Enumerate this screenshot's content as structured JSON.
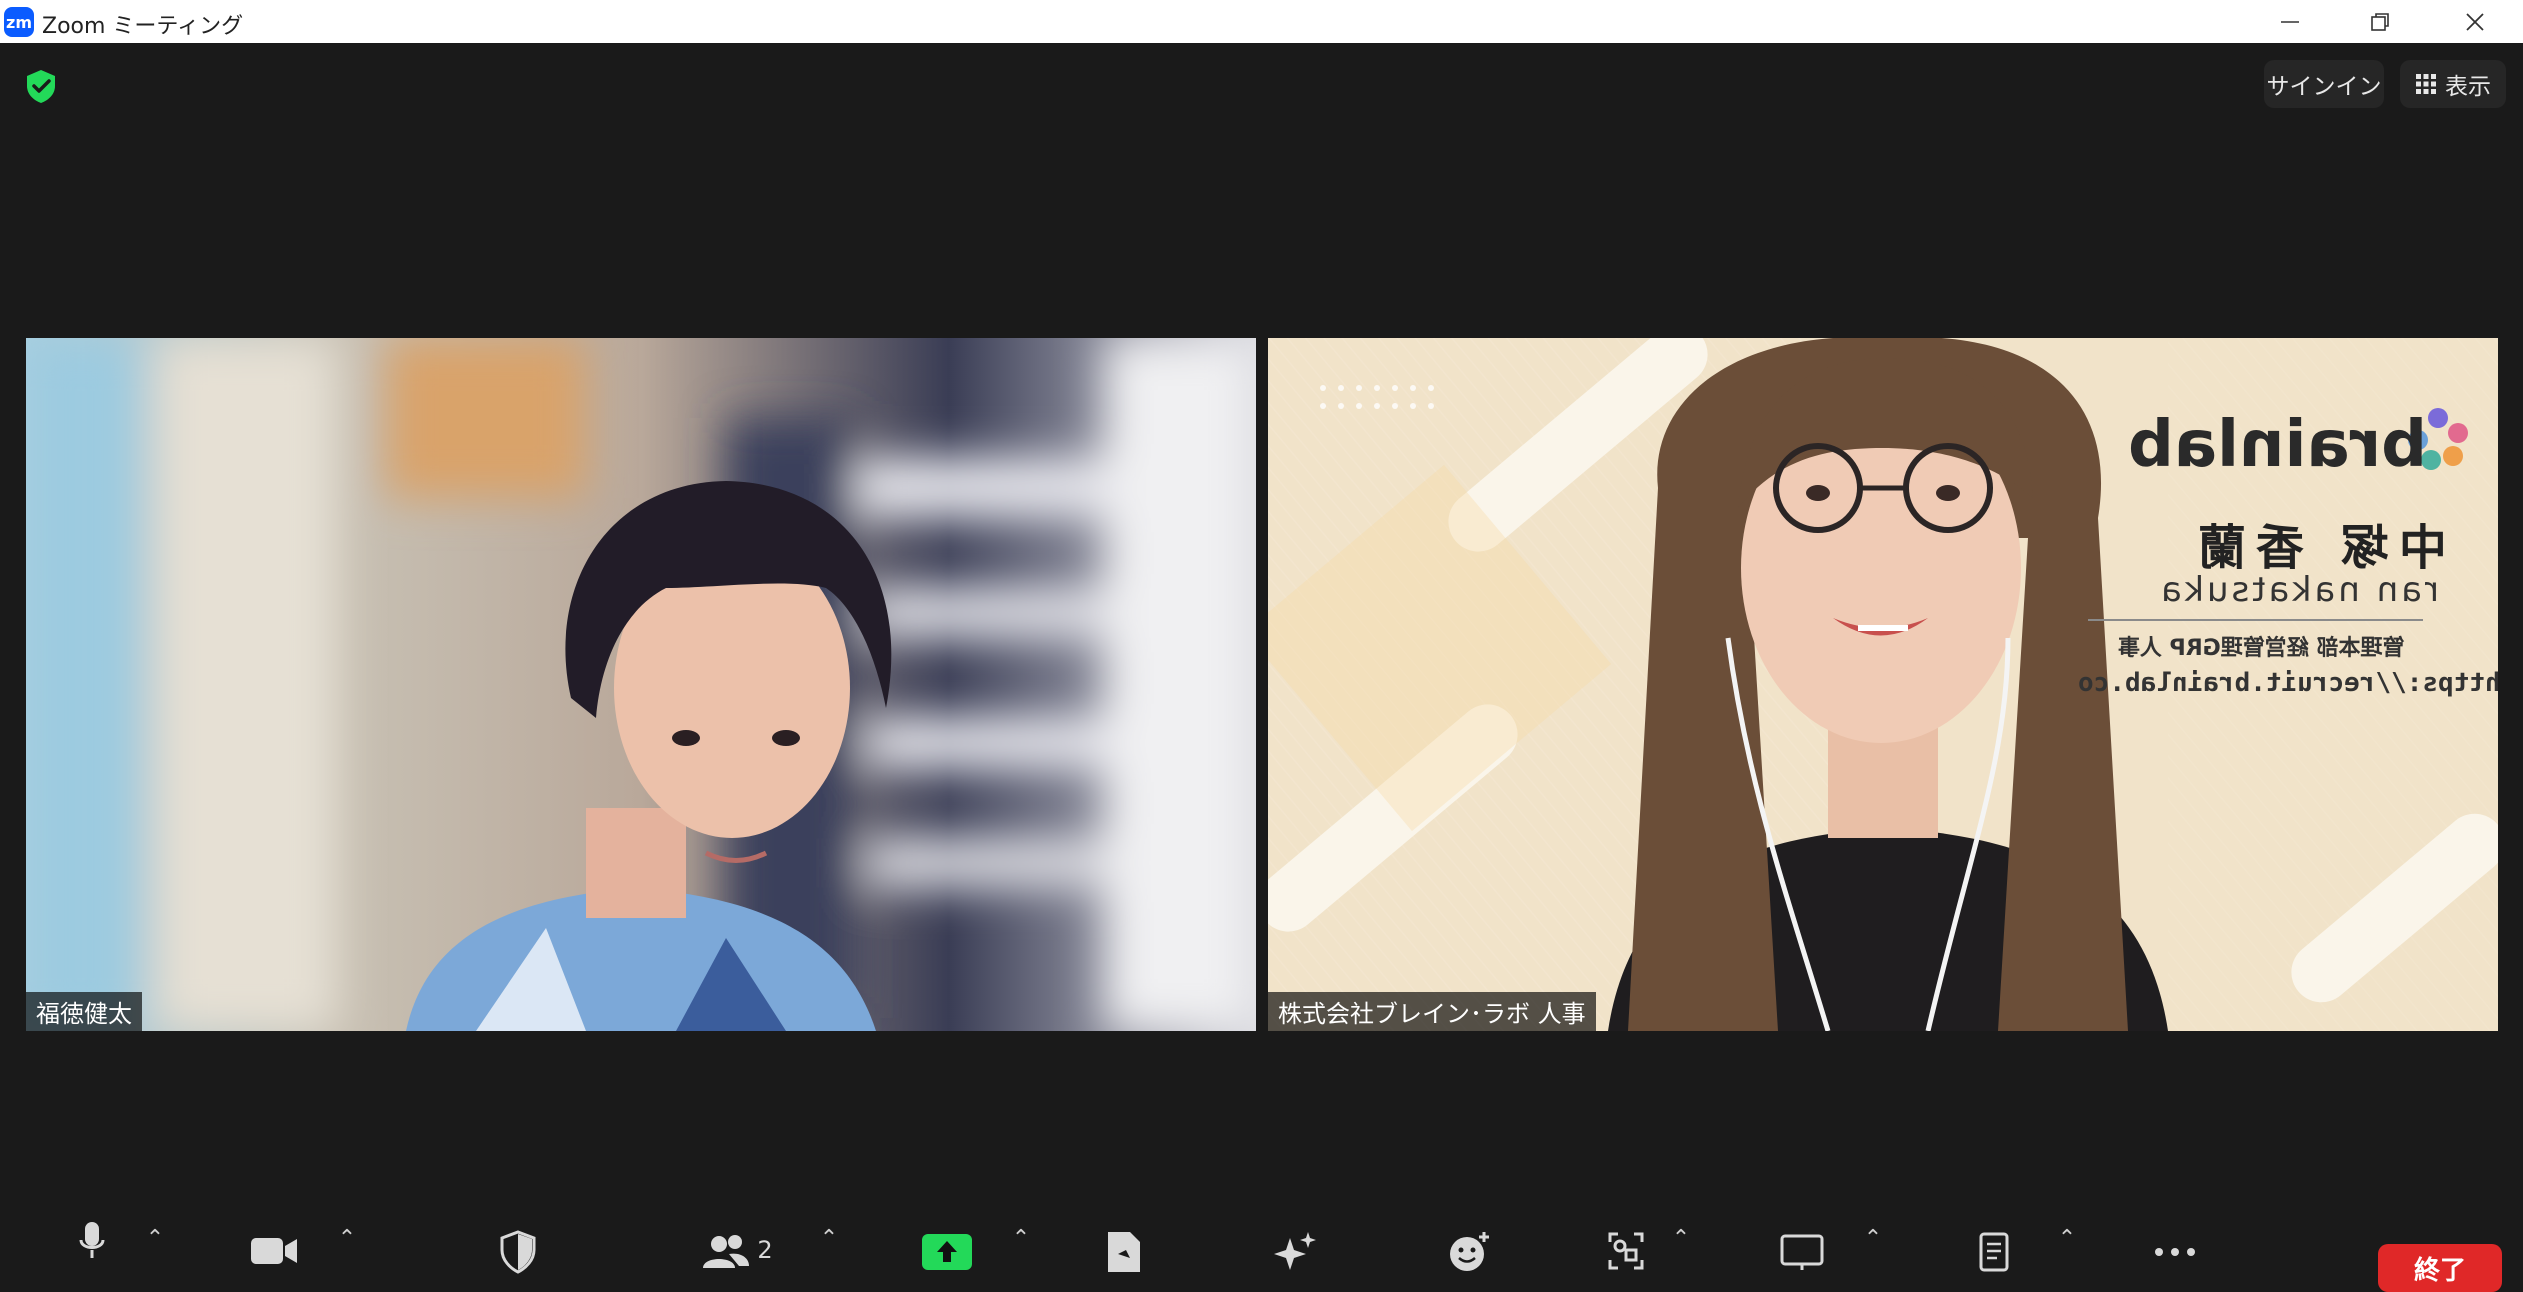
{
  "window": {
    "logo_text": "zm",
    "title": "Zoom ミーティング"
  },
  "header": {
    "signin_label": "サインイン",
    "view_label": "表示"
  },
  "participants": [
    {
      "name": "福徳健太"
    },
    {
      "name": "株式会社ブレイン･ラボ 人事"
    }
  ],
  "background_card": {
    "brand": "brainlab",
    "name_jp": "中塚 香蘭",
    "name_en": "ran nakatsuka",
    "department": "管理本部 経営管理GRP 人事",
    "url": "https://recruit.brainlab.co"
  },
  "toolbar": {
    "participants_count": "2",
    "end_label": "終了"
  },
  "colors": {
    "accent_green": "#23d959",
    "end_red": "#e02828",
    "brand_blue": "#0b5cff"
  }
}
